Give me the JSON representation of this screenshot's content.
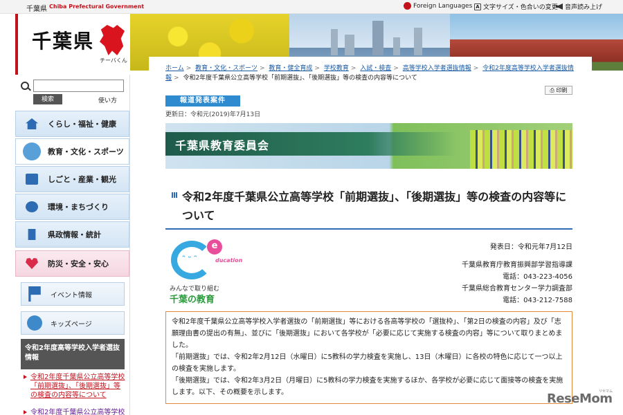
{
  "topbar": {
    "pref_name": "千葉県",
    "pref_en": "Chiba Prefectural Government",
    "foreign": "Foreign Languages",
    "font_color": "文字サイズ・色合いの変更",
    "read_aloud": "音声読み上げ",
    "a_glyph": "A"
  },
  "logo": {
    "text": "千葉県",
    "mascot": "チーバくん"
  },
  "search": {
    "button": "検索",
    "howto": "使い方"
  },
  "nav": [
    {
      "label": "くらし・福祉・健康"
    },
    {
      "label": "教育・文化・スポーツ"
    },
    {
      "label": "しごと・産業・観光"
    },
    {
      "label": "環境・まちづくり"
    },
    {
      "label": "県政情報・統計"
    },
    {
      "label": "防災・安全・安心"
    }
  ],
  "subnav": [
    {
      "label": "イベント情報"
    },
    {
      "label": "キッズページ"
    }
  ],
  "side": {
    "heading": "令和2年度高等学校入学者選抜情報",
    "links": [
      "令和2年度千葉県公立高等学校「前期選抜」、「後期選抜」等の検査の内容等について",
      "令和2年度千葉県公立高等学校"
    ]
  },
  "breadcrumb": {
    "items": [
      "ホーム",
      "教育・文化・スポーツ",
      "教育・健全育成",
      "学校教育",
      "入試・検査",
      "高等学校入学者選抜情報",
      "令和2年度高等学校入学者選抜情報"
    ],
    "current": "令和2年度千葉県公立高等学校「前期選抜」、「後期選抜」等の検査の内容等について"
  },
  "print_label": "印刷",
  "press_label": "報道発表案件",
  "updated": "更新日：令和元(2019)年7月13日",
  "hero_title": "千葉県教育委員会",
  "page_title": "令和2年度千葉県公立高等学校「前期選抜」、「後期選抜」等の検査の内容等について",
  "edu_logo": {
    "e": "e",
    "word": "ducation",
    "face": "ᵔ ᵕ ᵔ",
    "sub": "みんなで取り組む",
    "name": "千葉の教育"
  },
  "info": {
    "date": "発表日：令和元年7月12日",
    "dept1": "千葉県教育庁教育振興部学習指導課",
    "tel1": "電話：043-223-4056",
    "dept2": "千葉県総合教育センター学力調査部",
    "tel2": "電話：043-212-7588"
  },
  "summary": [
    "令和2年度千葉県公立高等学校入学者選抜の「前期選抜」等における各高等学校の「選抜枠」、「第2日の検査の内容」及び「志願理由書の提出の有無」、並びに「後期選抜」において各学校が「必要に応じて実施する検査の内容」等について取りまとめました。",
    "「前期選抜」では、令和2年2月12日（水曜日）に5教科の学力検査を実施し、13日（木曜日）に各校の特色に応じて一つ以上の検査を実施します。",
    "「後期選抜」では、令和2年3月2日（月曜日）に5教科の学力検査を実施するほか、各学校が必要に応じて面接等の検査を実施します。以下、その概要を示します。"
  ],
  "watermark": {
    "text": "ReseMom",
    "small": "リセマム"
  }
}
